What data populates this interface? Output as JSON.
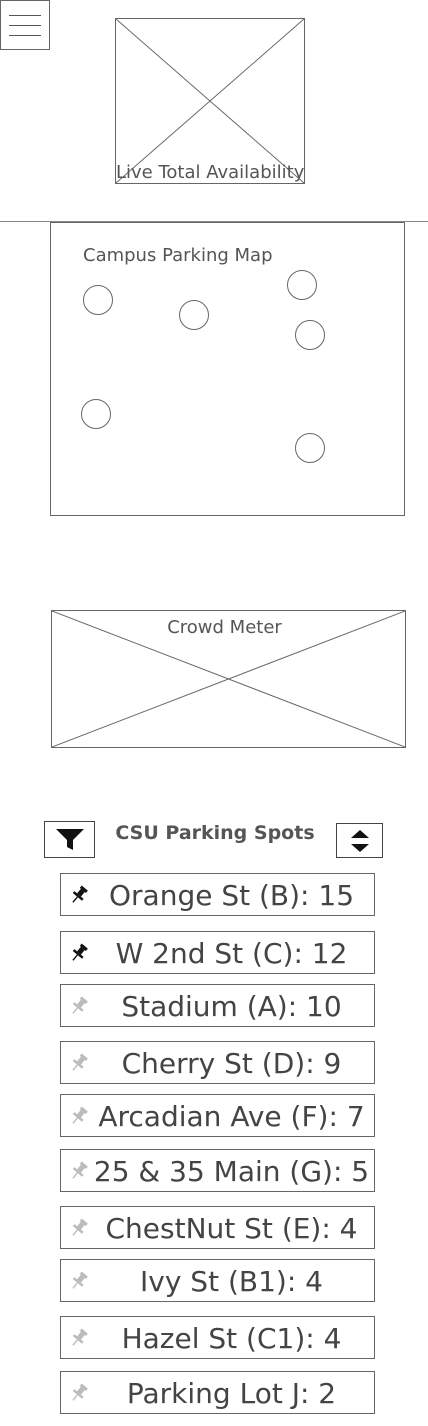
{
  "header": {
    "live_total_label": "Live Total Availability"
  },
  "map": {
    "title": "Campus Parking Map",
    "pin_icon": "circle-marker"
  },
  "crowd_meter": {
    "label": "Crowd Meter"
  },
  "parking_list": {
    "title": "CSU Parking Spots",
    "filter_icon": "filter-icon",
    "sort_icon": "sort-icon",
    "spots": [
      {
        "label": "Orange St (B): 15",
        "pinned": true
      },
      {
        "label": "W 2nd St (C): 12",
        "pinned": true
      },
      {
        "label": "Stadium (A): 10",
        "pinned": false
      },
      {
        "label": "Cherry St (D): 9",
        "pinned": false
      },
      {
        "label": "Arcadian Ave (F): 7",
        "pinned": false
      },
      {
        "label": "25 & 35 Main (G): 5",
        "pinned": false
      },
      {
        "label": "ChestNut St (E): 4",
        "pinned": false
      },
      {
        "label": "Ivy St (B1): 4",
        "pinned": false
      },
      {
        "label": "Hazel St (C1): 4",
        "pinned": false
      },
      {
        "label": "Parking Lot J: 2",
        "pinned": false
      }
    ]
  }
}
